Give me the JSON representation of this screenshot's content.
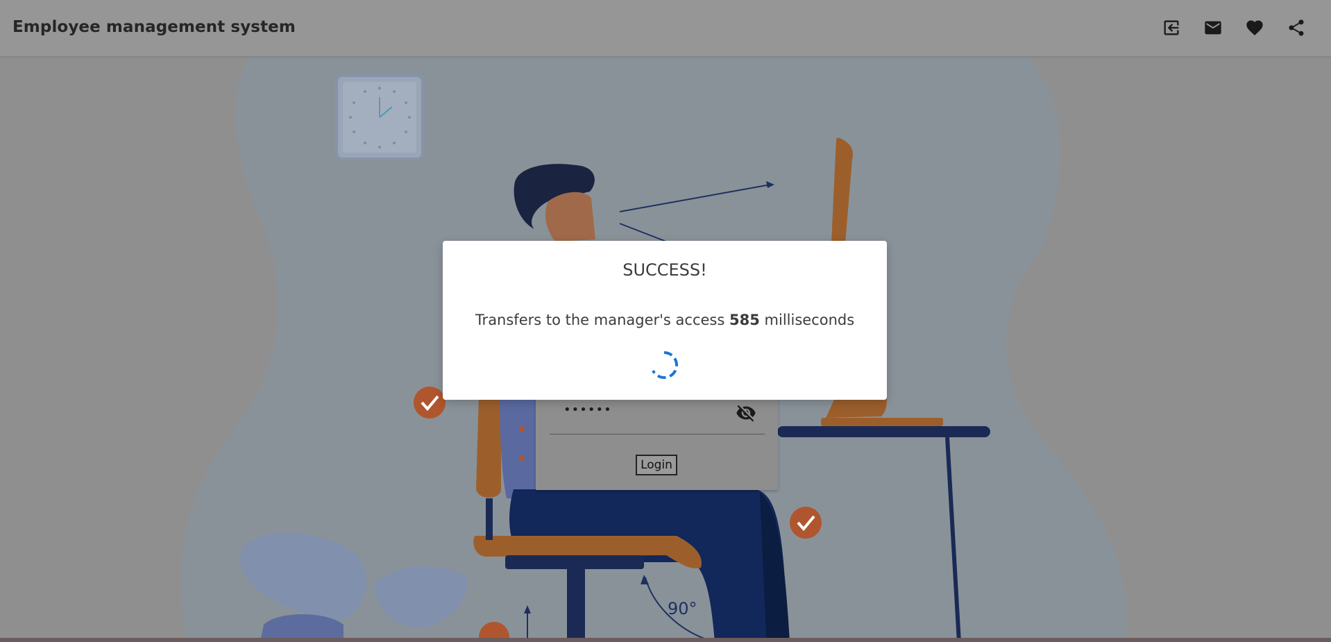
{
  "app": {
    "title": "Employee management system"
  },
  "toolbar": {
    "icons": [
      "exit-icon",
      "mail-icon",
      "heart-icon",
      "share-icon"
    ]
  },
  "login": {
    "password_mask": "••••••",
    "button_label": "Login"
  },
  "modal": {
    "title": "SUCCESS!",
    "message_prefix": "Transfers to the manager's access",
    "countdown_value": "585",
    "message_suffix": "milliseconds"
  },
  "illustration": {
    "angle_label": "90°"
  },
  "colors": {
    "appbar": "#969696",
    "backdrop": "#8f8f8f",
    "spinner": "#1976d2",
    "check_badge": "#b0562f"
  }
}
